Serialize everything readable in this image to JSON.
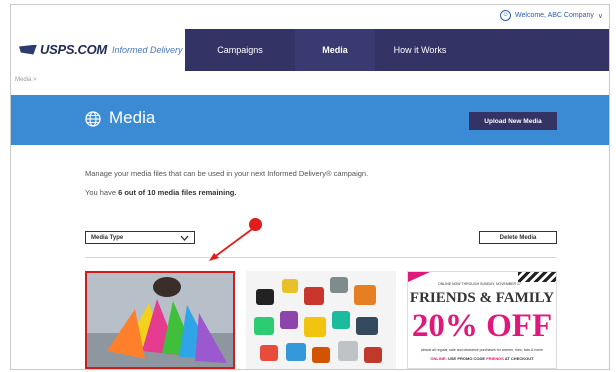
{
  "header": {
    "welcome_text": "Welcome, ABC Company",
    "brand": "USPS.COM",
    "product": "Informed Delivery",
    "nav_tabs": [
      {
        "label": "Campaigns"
      },
      {
        "label": "Media"
      },
      {
        "label": "How it Works"
      }
    ]
  },
  "breadcrumb": "Media",
  "hero": {
    "title": "Media",
    "upload_label": "Upload New Media"
  },
  "content": {
    "description": "Manage your media files that can be used in your next Informed Delivery® campaign.",
    "remaining_prefix": "You have ",
    "remaining_bold": "6 out of 10 media files remaining.",
    "filter_label": "Media Type",
    "delete_label": "Delete Media"
  },
  "thumbnails": {
    "ff_top": "ONLINE NOW THROUGH SUNDAY, NOVEMBER 17",
    "ff_title": "FRIENDS & FAMILY",
    "ff_offer": "20% OFF",
    "ff_fine": "almost all regular, sale and clearance purchases for women, men, kids & home",
    "ff_promo_a": "ONLINE:",
    "ff_promo_b": "USE PROMO CODE",
    "ff_promo_code": "FRIENDS",
    "ff_promo_c": "AT CHECKOUT"
  },
  "colors": {
    "nav": "#333366",
    "hero": "#3b8bd4",
    "highlight": "#d21c1c",
    "promo_pink": "#e0187b"
  }
}
